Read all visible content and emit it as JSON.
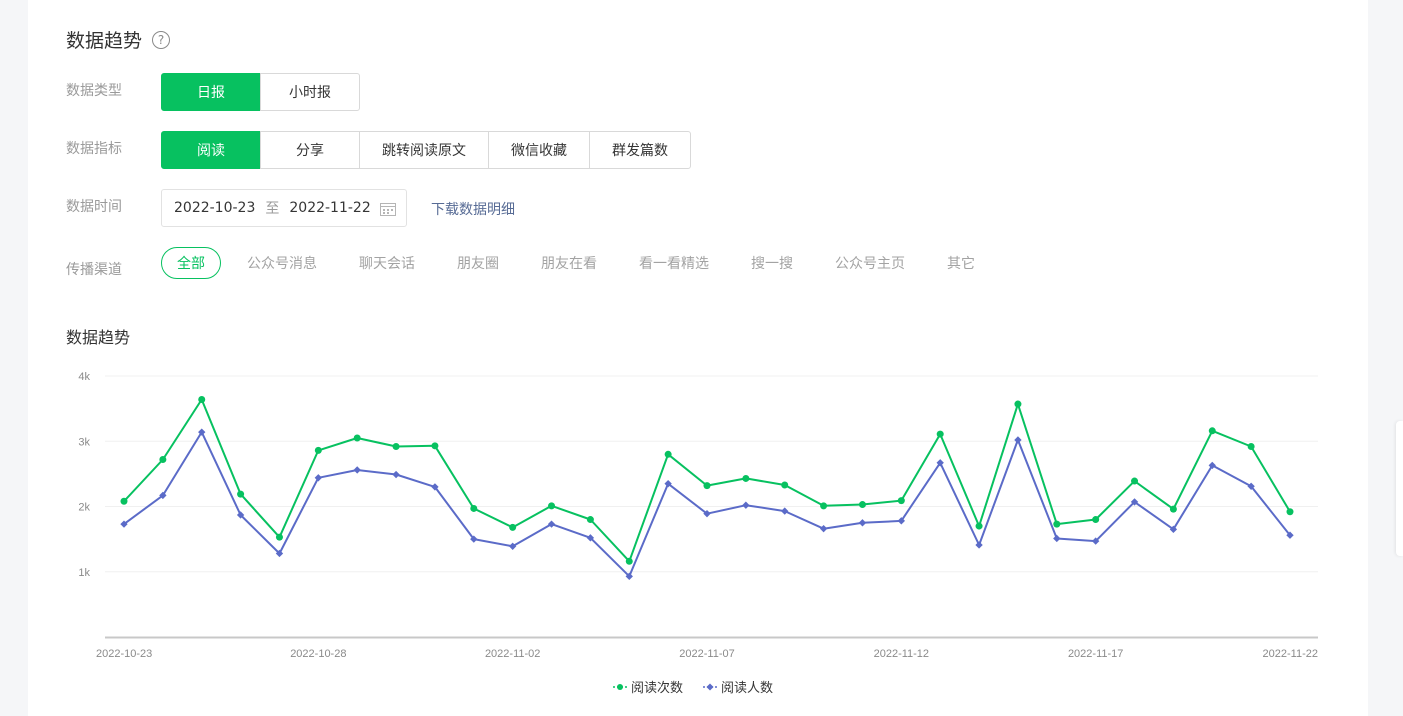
{
  "header": {
    "title": "数据趋势",
    "help_icon": "?"
  },
  "filters": {
    "data_type": {
      "label": "数据类型",
      "options": [
        "日报",
        "小时报"
      ],
      "selected": "日报"
    },
    "metric": {
      "label": "数据指标",
      "options": [
        "阅读",
        "分享",
        "跳转阅读原文",
        "微信收藏",
        "群发篇数"
      ],
      "selected": "阅读"
    },
    "time": {
      "label": "数据时间",
      "start": "2022-10-23",
      "separator": "至",
      "end": "2022-11-22",
      "download_label": "下载数据明细"
    },
    "channel": {
      "label": "传播渠道",
      "options": [
        "全部",
        "公众号消息",
        "聊天会话",
        "朋友圈",
        "朋友在看",
        "看一看精选",
        "搜一搜",
        "公众号主页",
        "其它"
      ],
      "selected": "全部"
    }
  },
  "colors": {
    "accent": "#07c160",
    "series2": "#5b6bc8",
    "link": "#576b95"
  },
  "chart_data": {
    "type": "line",
    "title": "数据趋势",
    "x": [
      "2022-10-23",
      "2022-10-24",
      "2022-10-25",
      "2022-10-26",
      "2022-10-27",
      "2022-10-28",
      "2022-10-29",
      "2022-10-30",
      "2022-10-31",
      "2022-11-01",
      "2022-11-02",
      "2022-11-03",
      "2022-11-04",
      "2022-11-05",
      "2022-11-06",
      "2022-11-07",
      "2022-11-08",
      "2022-11-09",
      "2022-11-10",
      "2022-11-11",
      "2022-11-12",
      "2022-11-13",
      "2022-11-14",
      "2022-11-15",
      "2022-11-16",
      "2022-11-17",
      "2022-11-18",
      "2022-11-19",
      "2022-11-20",
      "2022-11-21",
      "2022-11-22"
    ],
    "x_tick_labels": [
      "2022-10-23",
      "2022-10-28",
      "2022-11-02",
      "2022-11-07",
      "2022-11-12",
      "2022-11-17",
      "2022-11-22"
    ],
    "y_ticks": [
      1000,
      2000,
      3000,
      4000
    ],
    "y_tick_labels": [
      "1k",
      "2k",
      "3k",
      "4k"
    ],
    "ylim": [
      0,
      4000
    ],
    "grid": true,
    "legend_position": "bottom-center",
    "series": [
      {
        "name": "阅读次数",
        "color": "#07c160",
        "values": [
          2080,
          2720,
          3640,
          2190,
          1530,
          2860,
          3050,
          2920,
          2930,
          1970,
          1680,
          2010,
          1800,
          1160,
          2800,
          2320,
          2430,
          2330,
          2010,
          2030,
          2090,
          3110,
          1700,
          3570,
          1730,
          1800,
          2390,
          1960,
          3160,
          2920,
          1920
        ]
      },
      {
        "name": "阅读人数",
        "color": "#5b6bc8",
        "values": [
          1730,
          2170,
          3140,
          1870,
          1280,
          2440,
          2560,
          2490,
          2300,
          1500,
          1390,
          1730,
          1520,
          930,
          2350,
          1890,
          2020,
          1930,
          1660,
          1750,
          1780,
          2670,
          1410,
          3020,
          1510,
          1470,
          2070,
          1650,
          2630,
          2310,
          1560
        ]
      }
    ]
  }
}
